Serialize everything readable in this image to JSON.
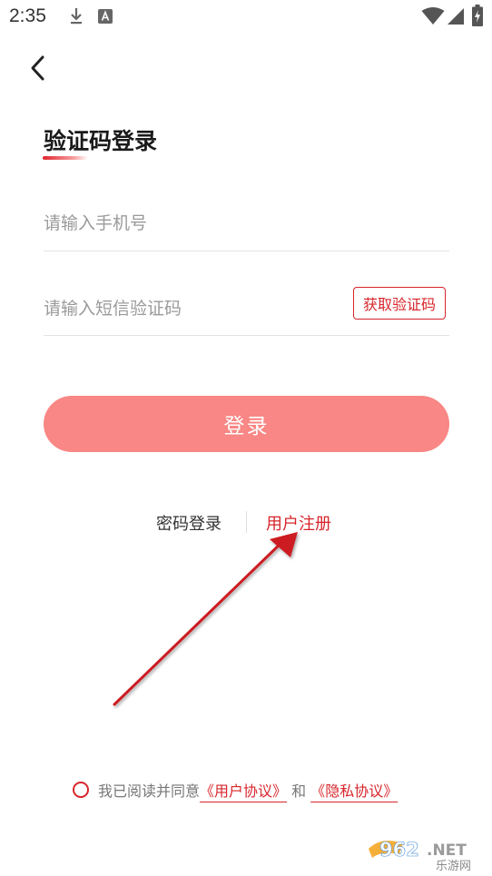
{
  "status_bar": {
    "time": "2:35",
    "icons": [
      "download-icon",
      "a-notification-icon",
      "wifi-icon",
      "signal-icon",
      "battery-charging-icon"
    ]
  },
  "header": {
    "back_icon": "chevron-left-icon",
    "title": "验证码登录"
  },
  "form": {
    "phone_placeholder": "请输入手机号",
    "phone_value": "",
    "sms_placeholder": "请输入短信验证码",
    "sms_value": "",
    "get_code_label": "获取验证码",
    "login_label": "登录"
  },
  "links": {
    "password_login": "密码登录",
    "register": "用户注册"
  },
  "agreement": {
    "prefix": "我已阅读并同意",
    "user_agreement": "《用户协议》",
    "and": "和",
    "privacy_policy": "《隐私协议》"
  },
  "watermark": {
    "brand": "962.NET",
    "sub": "乐游网"
  },
  "colors": {
    "accent": "#d7252b",
    "login_button": "#f88785",
    "placeholder": "#9a9a9a"
  }
}
